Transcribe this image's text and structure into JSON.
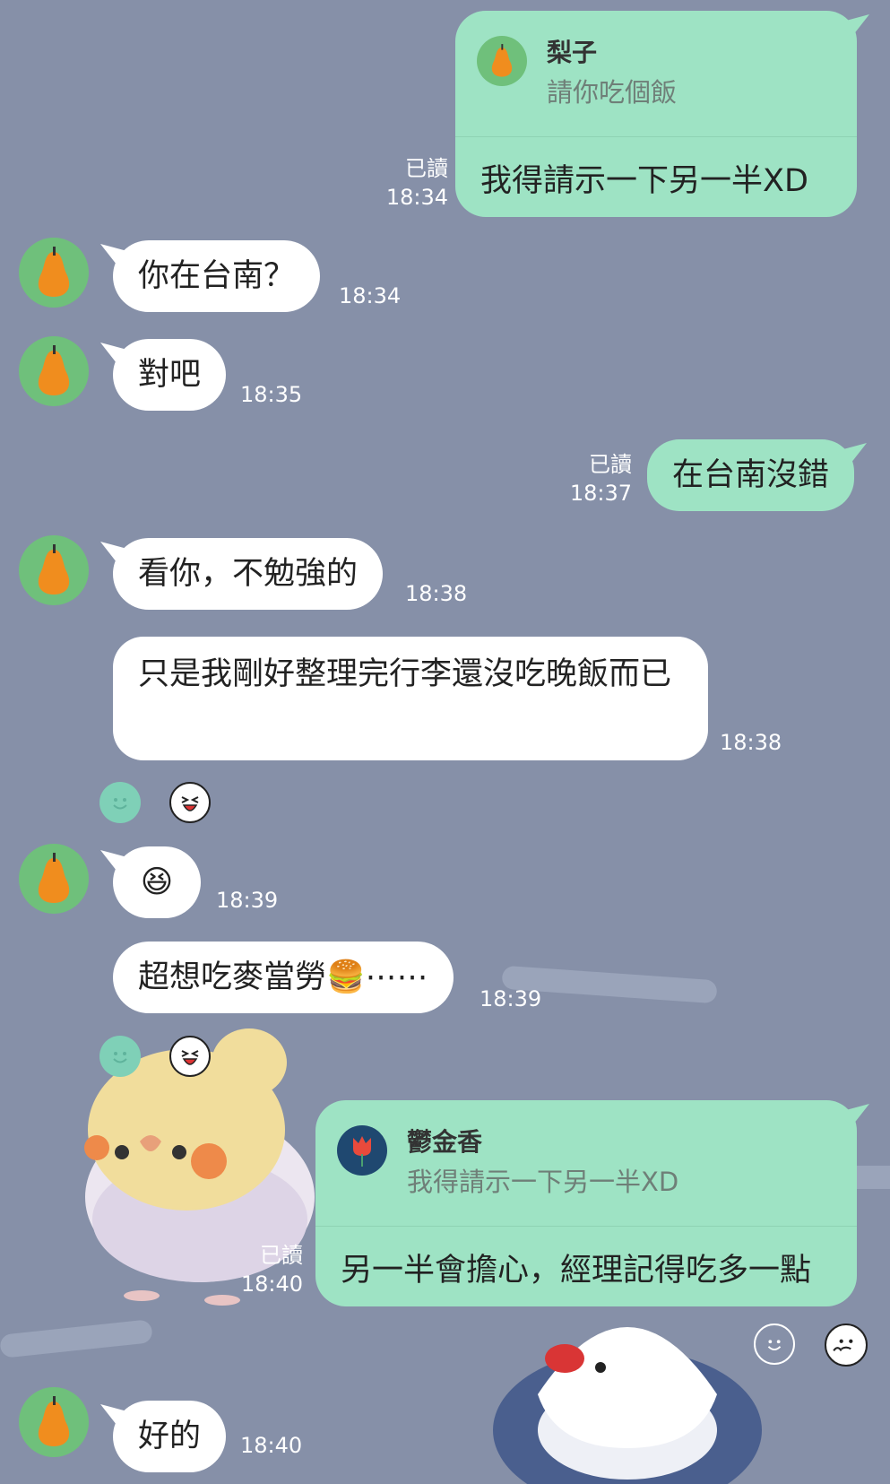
{
  "colors": {
    "background": "#8690a8",
    "incoming_bubble": "#ffffff",
    "outgoing_bubble": "#9ee3c4",
    "avatar": "#6fc07b",
    "meta_text": "#ffffff"
  },
  "messages": {
    "m1": {
      "quote_name": "梨子",
      "quote_text": "請你吃個飯",
      "text": "我得請示一下另一半XD",
      "read": "已讀",
      "time": "18:34"
    },
    "m2": {
      "text": "你在台南？",
      "time": "18:34"
    },
    "m3": {
      "text": "對吧",
      "time": "18:35"
    },
    "m4": {
      "text": "在台南沒錯",
      "read": "已讀",
      "time": "18:37"
    },
    "m5": {
      "text": "看你，不勉強的",
      "time": "18:38"
    },
    "m6": {
      "text": "只是我剛好整理完行李還沒吃晚飯而已",
      "time": "18:38"
    },
    "m7": {
      "emoji": "😆",
      "time": "18:39"
    },
    "m8": {
      "text": "超想吃麥當勞🍔⋯⋯",
      "time": "18:39"
    },
    "m9": {
      "quote_name": "鬱金香",
      "quote_text": "我得請示一下另一半XD",
      "text": "另一半會擔心，經理記得吃多一點",
      "read": "已讀",
      "time": "18:40"
    },
    "m10": {
      "text": "好的",
      "time": "18:40"
    }
  },
  "icons": {
    "avatar": "pear-icon",
    "quote_avatar_2": "tulip-icon",
    "reaction_add": "smiley-icon",
    "reaction": "laughing-face-icon",
    "sticker": "bird-sticker"
  }
}
